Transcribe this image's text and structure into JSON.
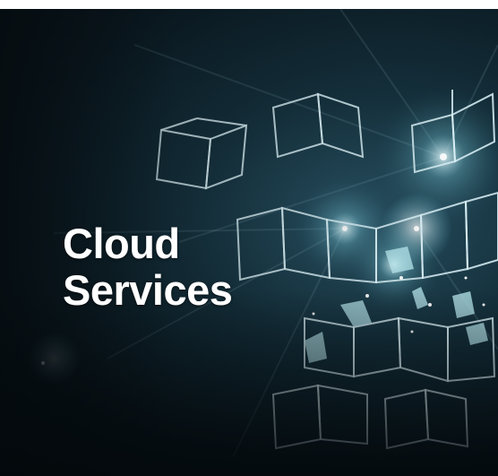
{
  "banner": {
    "title_line_1": "Cloud",
    "title_line_2": "Services",
    "background_image": "glowing-wireframe-cubes-photo",
    "colors": {
      "background_dark": "#0b1a22",
      "glow": "#9fe3f0",
      "title_text": "#ffffff"
    }
  }
}
